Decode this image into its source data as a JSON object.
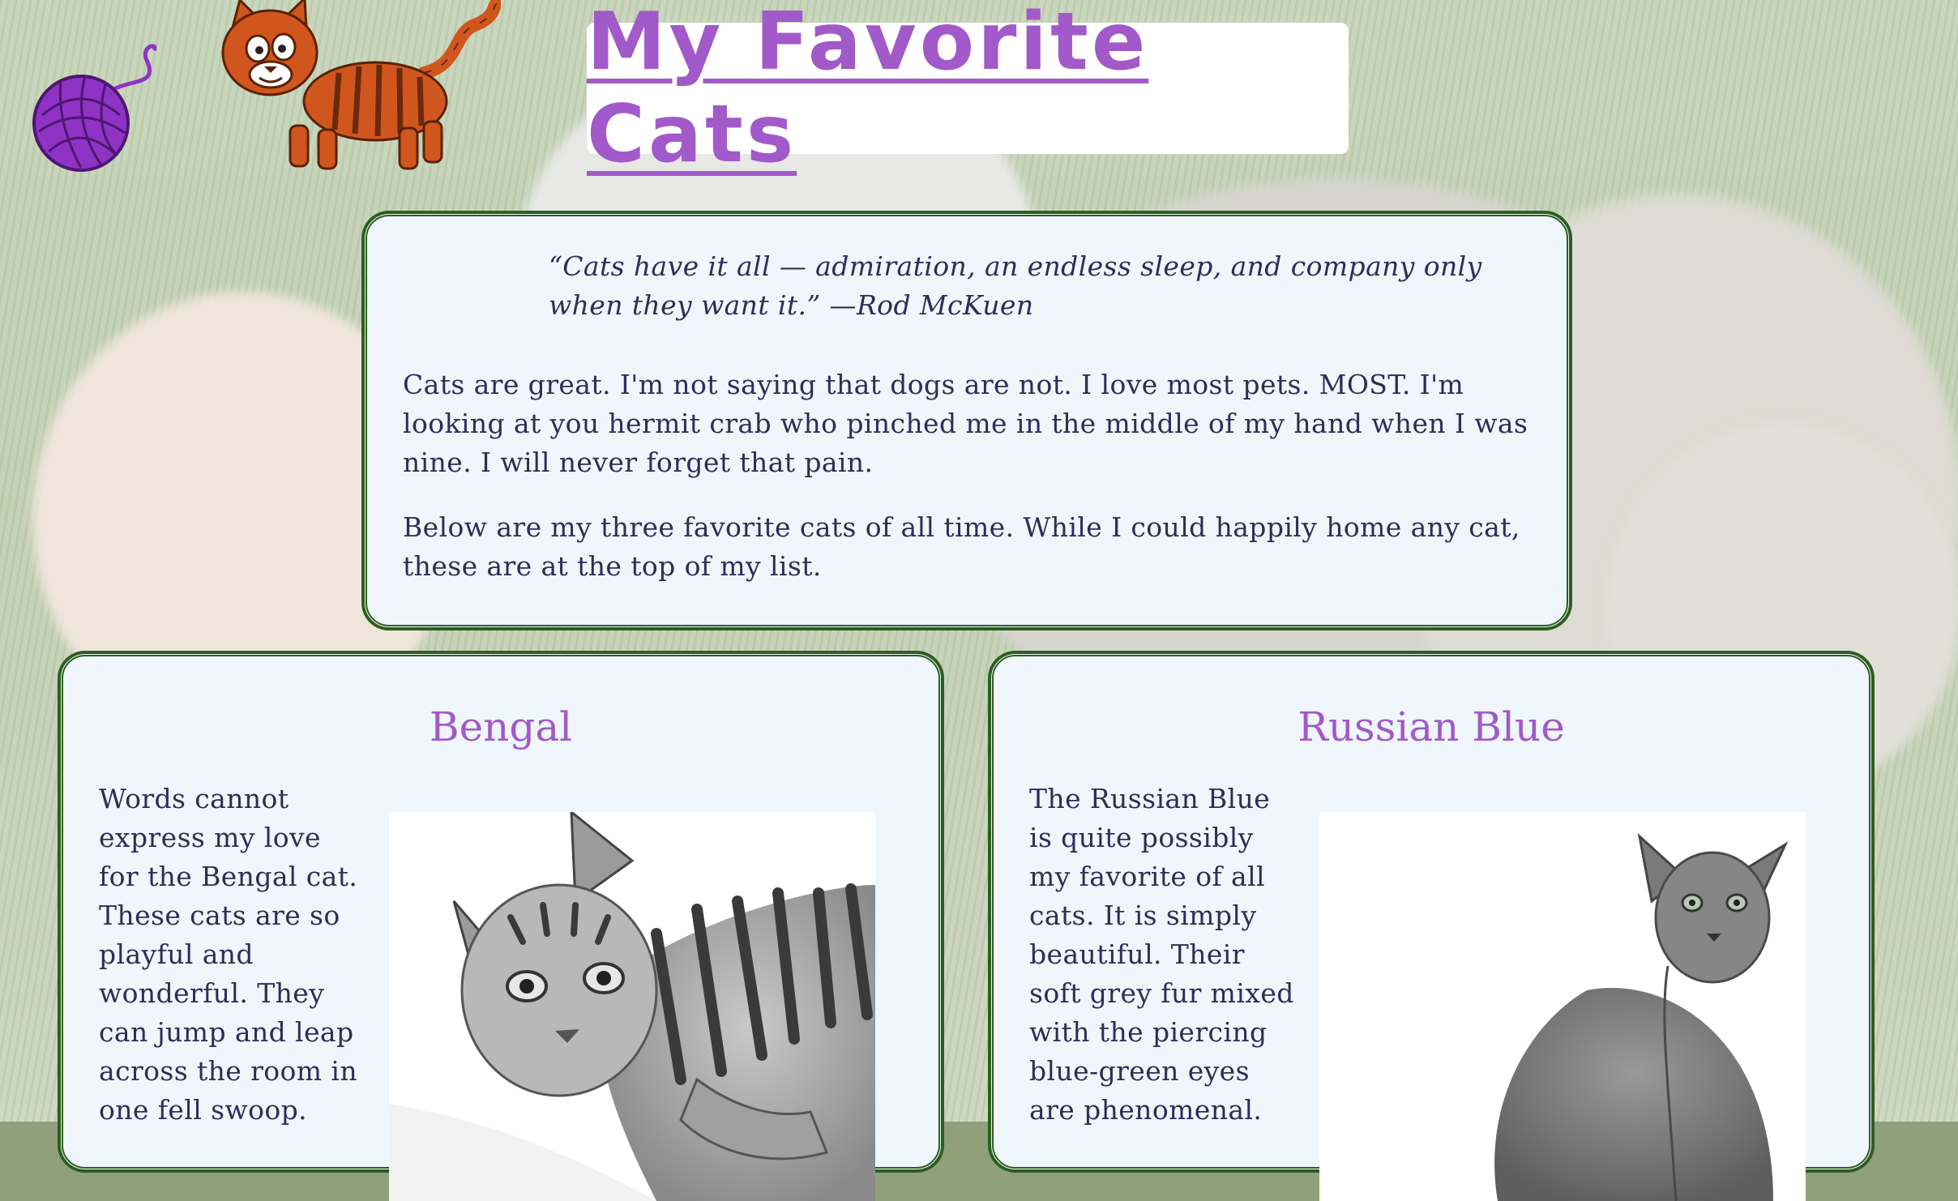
{
  "page": {
    "title": "My Favorite Cats"
  },
  "intro": {
    "quote": "“Cats have it all — admiration, an endless sleep, and company only when they want it.” —Rod McKuen",
    "paragraph_1": "Cats are great. I'm not saying that dogs are not. I love most pets. MOST. I'm looking at you hermit crab who pinched me in the middle of my hand when I was nine. I will never forget that pain.",
    "paragraph_2": "Below are my three favorite cats of all time. While I could happily home any cat, these are at the top of my list."
  },
  "breeds": [
    {
      "name": "Bengal",
      "description": "Words cannot express my love for the Bengal cat. These cats are so playful and wonderful. They can jump and leap across the room in one fell swoop."
    },
    {
      "name": "Russian Blue",
      "description": "The Russian Blue is quite possibly my favorite of all cats. It is simply beautiful. Their soft grey fur mixed with the piercing blue-green eyes are phenomenal."
    }
  ],
  "colors": {
    "title": "#a259c9",
    "card_background": "#eff6fc",
    "card_border": "#2c5e1e",
    "text": "#2f2d58"
  },
  "icons": [
    "yarn-ball-icon",
    "cartoon-cat-icon"
  ]
}
